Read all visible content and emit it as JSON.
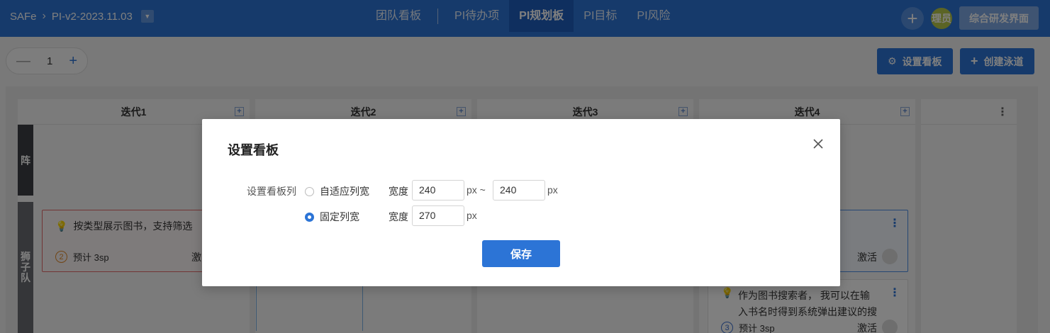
{
  "header": {
    "brand": "SAFe",
    "pi_selector": "PI-v2-2023.11.03",
    "tabs": [
      {
        "label": "团队看板"
      },
      {
        "label": "PI待办项"
      },
      {
        "label": "PI规划板"
      },
      {
        "label": "PI目标"
      },
      {
        "label": "PI风险"
      }
    ],
    "active_tab": "PI规划板",
    "avatar_text": "理员",
    "switch_button": "综合研发界面"
  },
  "toolbar": {
    "stepper_value": "1",
    "settings_button": "设置看板",
    "create_lane_button": "创建泳道"
  },
  "board": {
    "columns": [
      {
        "label": "迭代1"
      },
      {
        "label": "迭代2"
      },
      {
        "label": "迭代3"
      },
      {
        "label": "迭代4"
      }
    ],
    "lanes": [
      {
        "label": "阵"
      },
      {
        "label_chars": [
          "狮",
          "子",
          "队"
        ]
      }
    ],
    "cards": [
      {
        "title": "按类型展示图书，支持筛选",
        "points_badge": "2",
        "points": "预计 3sp",
        "status": "激"
      },
      {
        "status": "激活"
      },
      {
        "title_line1": "作为图书搜索者， 我可以在输",
        "title_line2": "入书名时得到系统弹出建议的搜",
        "points_badge": "3",
        "points": "预计 3sp",
        "status": "激活"
      }
    ]
  },
  "modal": {
    "title": "设置看板",
    "field_label": "设置看板列",
    "option_adaptive": "自适应列宽",
    "option_fixed": "固定列宽",
    "selected_option": "固定列宽",
    "width_label": "宽度",
    "adaptive_min": "240",
    "adaptive_max": "240",
    "fixed_width": "270",
    "unit_px": "px",
    "unit_px_range": "px ~",
    "save_button": "保存"
  },
  "colors": {
    "primary": "#2c74d6",
    "header_bg": "#2c74d6",
    "card_red_border": "#e26a6a",
    "card_blue_border": "#4c8fe6"
  }
}
